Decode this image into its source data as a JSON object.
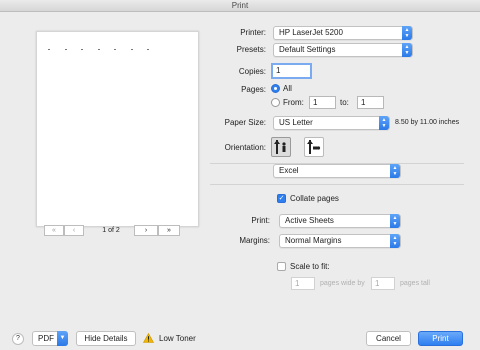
{
  "window": {
    "title": "Print"
  },
  "preview": {
    "first_label": "«",
    "prev_label": "‹",
    "page_indicator": "1 of 2",
    "next_label": "›",
    "last_label": "»"
  },
  "printer": {
    "label": "Printer:",
    "value": "HP LaserJet 5200"
  },
  "presets": {
    "label": "Presets:",
    "value": "Default Settings"
  },
  "copies": {
    "label": "Copies:",
    "value": "1"
  },
  "pages": {
    "label": "Pages:",
    "all_label": "All",
    "from_label": "From:",
    "from_value": "1",
    "to_label": "to:",
    "to_value": "1",
    "selected": "All"
  },
  "paper_size": {
    "label": "Paper Size:",
    "value": "US Letter",
    "dimensions": "8.50 by 11.00 inches"
  },
  "orientation": {
    "label": "Orientation:",
    "selected": "portrait"
  },
  "app_section": {
    "value": "Excel"
  },
  "collate": {
    "label": "Collate pages",
    "checked": true
  },
  "print_what": {
    "label": "Print:",
    "value": "Active Sheets"
  },
  "margins": {
    "label": "Margins:",
    "value": "Normal Margins"
  },
  "scale": {
    "label": "Scale to fit:",
    "checked": false,
    "pages_wide_value": "1",
    "pages_wide_label": "pages wide by",
    "pages_tall_value": "1",
    "pages_tall_label": "pages tall"
  },
  "footer": {
    "help_label": "?",
    "pdf_label": "PDF",
    "hide_details_label": "Hide Details",
    "warning_icon": "warning-triangle-icon",
    "low_toner_label": "Low Toner",
    "cancel_label": "Cancel",
    "print_label": "Print"
  },
  "colors": {
    "accent": "#2f7ff0",
    "warning": "#f2b600"
  }
}
